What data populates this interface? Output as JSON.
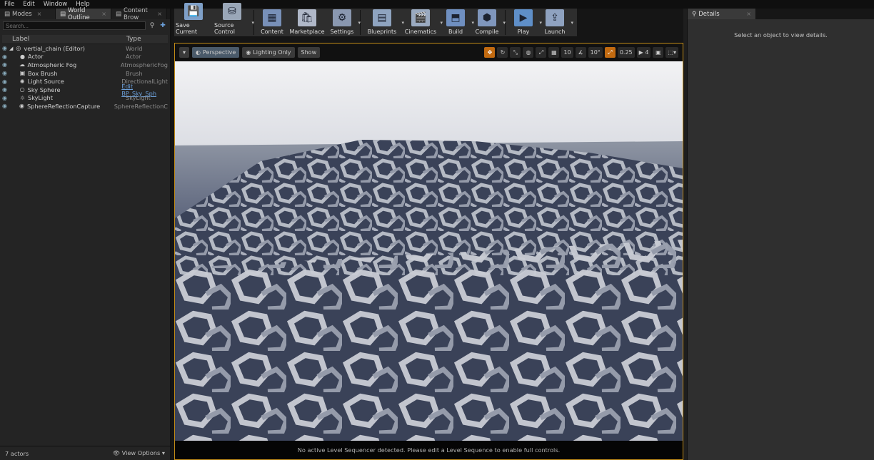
{
  "menu": [
    "File",
    "Edit",
    "Window",
    "Help"
  ],
  "left_tabs": [
    {
      "label": "Modes"
    },
    {
      "label": "World Outline"
    },
    {
      "label": "Content Brow"
    }
  ],
  "search": {
    "placeholder": "Search..."
  },
  "columns": {
    "label": "Label",
    "type": "Type"
  },
  "outliner": [
    {
      "name": "vertial_chain (Editor)",
      "type": "World",
      "icon": "world-icon",
      "link": false
    },
    {
      "name": "Actor",
      "type": "Actor",
      "icon": "actor-icon",
      "link": false
    },
    {
      "name": "Atmospheric Fog",
      "type": "AtmosphericFog",
      "icon": "fog-icon",
      "link": false
    },
    {
      "name": "Box Brush",
      "type": "Brush",
      "icon": "box-brush-icon",
      "link": false
    },
    {
      "name": "Light Source",
      "type": "DirectionalLight",
      "icon": "directional-light-icon",
      "link": false
    },
    {
      "name": "Sky Sphere",
      "type": "Edit BP_Sky_Sph",
      "icon": "sphere-icon",
      "link": true
    },
    {
      "name": "SkyLight",
      "type": "SkyLight",
      "icon": "skylight-icon",
      "link": false
    },
    {
      "name": "SphereReflectionCapture",
      "type": "SphereReflectionC",
      "icon": "reflection-capture-icon",
      "link": false
    }
  ],
  "footer": {
    "count": "7 actors",
    "view_options": "View Options"
  },
  "toolbar": [
    {
      "label": "Save Current",
      "icon": "save-icon",
      "color": "#7fa0c8",
      "dropdown": false
    },
    {
      "label": "Source Control",
      "icon": "source-control-icon",
      "color": "#9aa7b8",
      "dropdown": true
    },
    {
      "label": "Content",
      "icon": "content-icon",
      "color": "#7890b8",
      "dropdown": false
    },
    {
      "label": "Marketplace",
      "icon": "marketplace-icon",
      "color": "#b0b8c8",
      "dropdown": false
    },
    {
      "label": "Settings",
      "icon": "settings-icon",
      "color": "#8a98b0",
      "dropdown": true
    },
    {
      "label": "Blueprints",
      "icon": "blueprints-icon",
      "color": "#8fa4c0",
      "dropdown": true
    },
    {
      "label": "Cinematics",
      "icon": "cinematics-icon",
      "color": "#9aaac0",
      "dropdown": true
    },
    {
      "label": "Build",
      "icon": "build-icon",
      "color": "#6f8fc0",
      "dropdown": true
    },
    {
      "label": "Compile",
      "icon": "compile-icon",
      "color": "#7f96bc",
      "dropdown": true
    },
    {
      "label": "Play",
      "icon": "play-icon",
      "color": "#5f8fc8",
      "dropdown": true
    },
    {
      "label": "Launch",
      "icon": "launch-icon",
      "color": "#8fa2c0",
      "dropdown": true
    }
  ],
  "viewport": {
    "perspective": "Perspective",
    "lighting": "Lighting Only",
    "show": "Show",
    "grid_snap": "10",
    "rotation_snap": "10°",
    "scale_snap": "0.25",
    "camera_speed": "4",
    "message": "No active Level Sequencer detected. Please edit a Level Sequence to enable full controls."
  },
  "details": {
    "tab": "Details",
    "message": "Select an object to view details."
  },
  "colors": {
    "accent": "#c08a16",
    "link": "#6b9fd9",
    "snap_active": "#c26a10"
  }
}
